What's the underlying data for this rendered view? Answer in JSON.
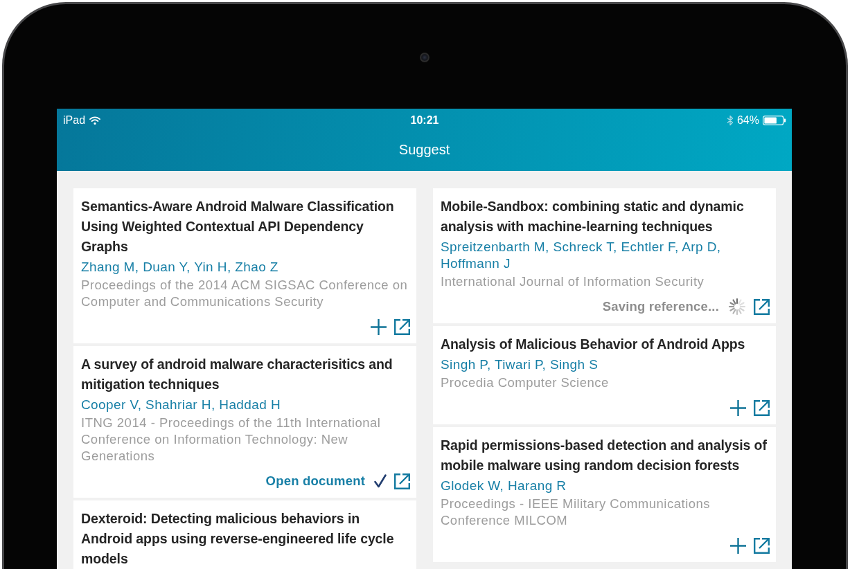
{
  "status_bar": {
    "device": "iPad",
    "time": "10:21",
    "battery": "64%"
  },
  "navigation": {
    "title": "Suggest"
  },
  "columns": [
    {
      "cards": [
        {
          "title": "Semantics-Aware Android Malware Classification Using Weighted Contextual API Dependency Graphs",
          "authors": "Zhang M, Duan Y, Yin H, Zhao Z",
          "source": "Proceedings of the 2014 ACM SIGSAC Conference on Computer and Communications Security",
          "status": {
            "kind": "add"
          }
        },
        {
          "title": "A survey of android malware characterisitics and mitigation techniques",
          "authors": "Cooper V, Shahriar H, Haddad H",
          "source": "ITNG 2014 - Proceedings of the 11th International Conference on Information Technology: New Generations",
          "status": {
            "kind": "saved",
            "label": "Open document"
          }
        },
        {
          "title": "Dexteroid: Detecting malicious behaviors in Android apps using reverse-engineered life cycle models"
        }
      ]
    },
    {
      "cards": [
        {
          "title": "Mobile-Sandbox: combining static and dynamic analysis with machine-learning techniques",
          "authors": "Spreitzenbarth M, Schreck T, Echtler F, Arp D, Hoffmann J",
          "source": "International Journal of Information Security",
          "status": {
            "kind": "saving",
            "label": "Saving reference..."
          }
        },
        {
          "title": "Analysis of Malicious Behavior of Android Apps",
          "authors": "Singh P, Tiwari P, Singh S",
          "source": "Procedia Computer Science",
          "status": {
            "kind": "add"
          }
        },
        {
          "title": "Rapid permissions-based detection and analysis of mobile malware using random decision forests",
          "authors": "Glodek W, Harang R",
          "source": "Proceedings - IEEE Military Communications Conference MILCOM",
          "status": {
            "kind": "add"
          }
        }
      ]
    }
  ]
}
